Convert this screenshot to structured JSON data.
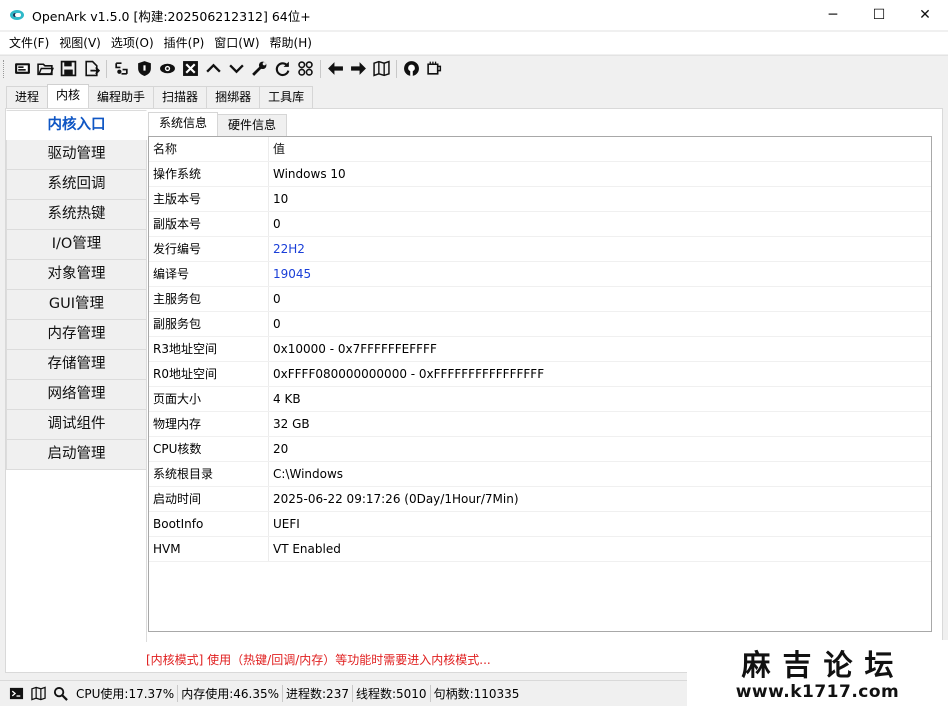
{
  "window": {
    "title": "OpenArk v1.5.0 [构建:202506212312]  64位+",
    "minimize": "─",
    "maximize": "☐",
    "close": "✕"
  },
  "menu": [
    "文件(F)",
    "视图(V)",
    "选项(O)",
    "插件(P)",
    "窗口(W)",
    "帮助(H)"
  ],
  "toolbar_icons": [
    "console-icon",
    "open-folder-icon",
    "save-icon",
    "export-icon",
    "link-icon",
    "shield-icon",
    "eye-icon",
    "kill-icon",
    "up-icon",
    "down-icon",
    "wrench-icon",
    "refresh-icon",
    "grid-icon",
    "back-icon",
    "forward-icon",
    "map-icon",
    "github-icon",
    "cup-icon"
  ],
  "main_tabs": [
    "进程",
    "内核",
    "编程助手",
    "扫描器",
    "捆绑器",
    "工具库"
  ],
  "active_main_tab": 1,
  "side_items": [
    "内核入口",
    "驱动管理",
    "系统回调",
    "系统热键",
    "I/O管理",
    "对象管理",
    "GUI管理",
    "内存管理",
    "存储管理",
    "网络管理",
    "调试组件",
    "启动管理"
  ],
  "inner_tabs": [
    "系统信息",
    "硬件信息"
  ],
  "table": {
    "header": [
      "名称",
      "值"
    ],
    "rows": [
      {
        "name": "操作系统",
        "value": "Windows 10",
        "link": false
      },
      {
        "name": "主版本号",
        "value": "10",
        "link": false
      },
      {
        "name": "副版本号",
        "value": "0",
        "link": false
      },
      {
        "name": "发行编号",
        "value": "22H2",
        "link": true
      },
      {
        "name": "编译号",
        "value": "19045",
        "link": true
      },
      {
        "name": "主服务包",
        "value": "0",
        "link": false
      },
      {
        "name": "副服务包",
        "value": "0",
        "link": false
      },
      {
        "name": "R3地址空间",
        "value": "0x10000 - 0x7FFFFFFEFFFF",
        "link": false
      },
      {
        "name": "R0地址空间",
        "value": "0xFFFF080000000000 - 0xFFFFFFFFFFFFFFFF",
        "link": false
      },
      {
        "name": "页面大小",
        "value": "4 KB",
        "link": false
      },
      {
        "name": "物理内存",
        "value": "32 GB",
        "link": false
      },
      {
        "name": "CPU核数",
        "value": "20",
        "link": false
      },
      {
        "name": "系统根目录",
        "value": "C:\\Windows",
        "link": false
      },
      {
        "name": "启动时间",
        "value": "2025-06-22 09:17:26 (0Day/1Hour/7Min)",
        "link": false
      },
      {
        "name": "BootInfo",
        "value": "UEFI",
        "link": false
      },
      {
        "name": "HVM",
        "value": "VT Enabled",
        "link": false
      }
    ]
  },
  "tip": "[内核模式] 使用（热键/回调/内存）等功能时需要进入内核模式...",
  "status": {
    "cpu": "CPU使用:17.37%",
    "mem": "内存使用:46.35%",
    "procs": "进程数:237",
    "threads": "线程数:5010",
    "handles": "句柄数:110335"
  },
  "watermark": {
    "line1": "麻吉论坛",
    "line2": "www.k1717.com"
  },
  "colors": {
    "active_side": "#0f56c4",
    "link": "#1a3fd8",
    "tip": "#e02020"
  }
}
